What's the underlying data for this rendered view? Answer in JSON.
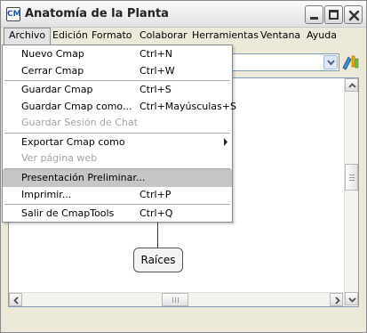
{
  "window": {
    "title": "Anatomía de la Planta",
    "app_icon_text": "CM"
  },
  "menubar": {
    "items": [
      "Archivo",
      "Edición",
      "Formato",
      "Colaborar",
      "Herramientas",
      "Ventana",
      "Ayuda"
    ],
    "active": "Archivo"
  },
  "file_menu": {
    "items": [
      {
        "label": "Nuevo Cmap",
        "shortcut": "Ctrl+N",
        "enabled": true
      },
      {
        "label": "Cerrar Cmap",
        "shortcut": "Ctrl+W",
        "enabled": true
      },
      {
        "label": "Guardar Cmap",
        "shortcut": "Ctrl+S",
        "enabled": true
      },
      {
        "label": "Guardar Cmap como...",
        "shortcut": "Ctrl+Mayúsculas+S",
        "enabled": true
      },
      {
        "label": "Guardar Sesión de Chat",
        "shortcut": "",
        "enabled": false
      },
      {
        "label": "Exportar Cmap como",
        "shortcut": "",
        "enabled": true,
        "submenu": true
      },
      {
        "label": "Ver página web",
        "shortcut": "",
        "enabled": false
      },
      {
        "label": "Presentación Preliminar...",
        "shortcut": "",
        "enabled": true,
        "highlighted": true
      },
      {
        "label": "Imprimir...",
        "shortcut": "Ctrl+P",
        "enabled": true
      },
      {
        "label": "Salir de CmapTools",
        "shortcut": "Ctrl+Q",
        "enabled": true
      }
    ]
  },
  "canvas": {
    "concept_label": "Raíces"
  },
  "colors": {
    "highlight": "#c6c6c6",
    "disabled_text": "#a3a3a3",
    "window_bg": "#ece9d8",
    "field_border": "#7f9db9"
  }
}
